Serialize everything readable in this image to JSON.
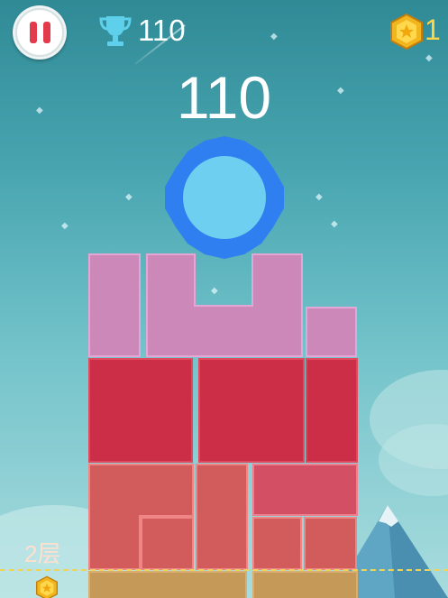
{
  "hud": {
    "best_score": "110",
    "coins": "1",
    "pause_icon": "pause-icon",
    "trophy_icon": "trophy-icon",
    "coin_icon": "coin-icon"
  },
  "game": {
    "score": "110",
    "floor_label": "2层"
  },
  "colors": {
    "ball_outer": "#2f7ff0",
    "ball_inner": "#6ecff0",
    "pink_block": "#cc88b8",
    "red_block": "#cc2e47",
    "salmon_block": "#d25c5c",
    "tan_block": "#c59958",
    "pause_red": "#e13b4c",
    "coin_gold": "#ffd54a"
  }
}
